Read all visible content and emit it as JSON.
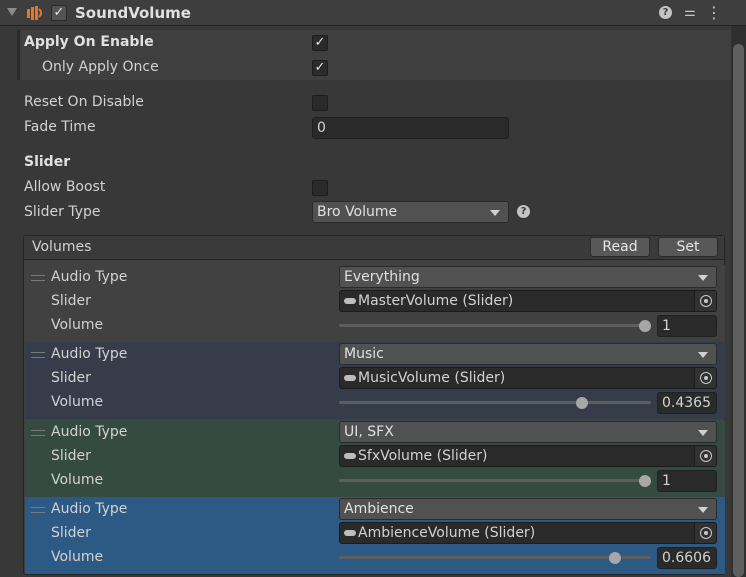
{
  "header": {
    "title": "SoundVolume",
    "enabled_check": "✓",
    "help_icon": "?",
    "presets_icon": "⚌",
    "menu_icon": "⋮"
  },
  "fields": {
    "apply_on_enable": {
      "label": "Apply On Enable",
      "check": "✓"
    },
    "only_apply_once": {
      "label": "Only Apply Once",
      "check": "✓"
    },
    "reset_on_disable": {
      "label": "Reset On Disable",
      "check": ""
    },
    "fade_time": {
      "label": "Fade Time",
      "value": "0"
    },
    "slider_section": "Slider",
    "allow_boost": {
      "label": "Allow Boost",
      "check": ""
    },
    "slider_type": {
      "label": "Slider Type",
      "value": "Bro Volume",
      "help": "?"
    }
  },
  "volumes": {
    "title": "Volumes",
    "read_label": "Read",
    "set_label": "Set",
    "items": [
      {
        "audio_type_label": "Audio Type",
        "audio_type": "Everything",
        "slider_label": "Slider",
        "slider": "MasterVolume (Slider)",
        "volume_label": "Volume",
        "volume": "1",
        "volume_fraction": 1.0,
        "bg": "#414141"
      },
      {
        "audio_type_label": "Audio Type",
        "audio_type": "Music",
        "slider_label": "Slider",
        "slider": "MusicVolume (Slider)",
        "volume_label": "Volume",
        "volume": "0.4365",
        "volume_fraction": 0.79,
        "bg": "#373c4a"
      },
      {
        "audio_type_label": "Audio Type",
        "audio_type": "UI, SFX",
        "slider_label": "Slider",
        "slider": "SfxVolume (Slider)",
        "volume_label": "Volume",
        "volume": "1",
        "volume_fraction": 1.0,
        "bg": "#354a40"
      },
      {
        "audio_type_label": "Audio Type",
        "audio_type": "Ambience",
        "slider_label": "Slider",
        "slider": "AmbienceVolume (Slider)",
        "volume_label": "Volume",
        "volume": "0.6606",
        "volume_fraction": 0.9,
        "bg": "#2c5a85"
      }
    ]
  },
  "colors": {
    "accent_selected": "#2c5a85",
    "icon_orange": "#e8742a"
  }
}
